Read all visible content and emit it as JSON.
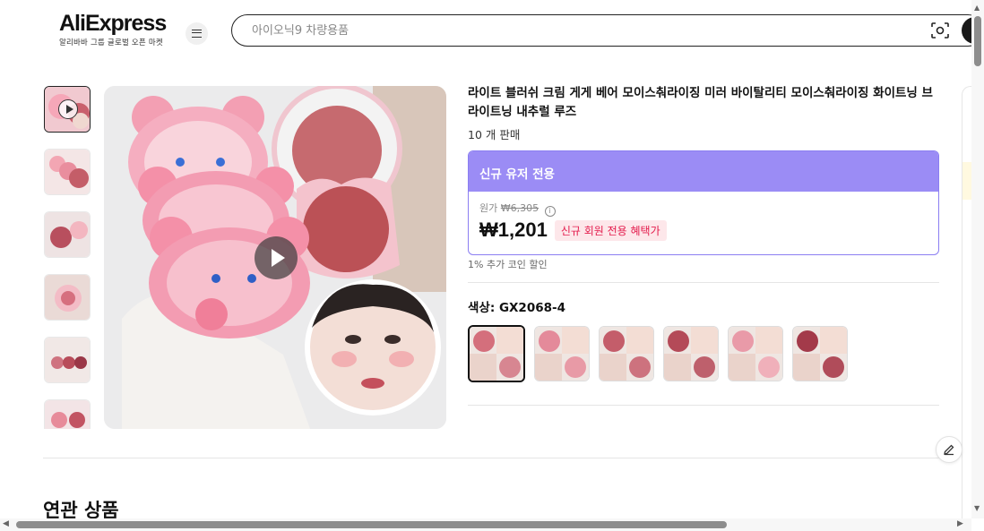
{
  "header": {
    "logo_text": "AliExpress",
    "logo_subtitle": "알리바바 그룹 글로벌 오픈 마켓",
    "menu_icon": "hamburger-icon",
    "search_placeholder": "아이오닉9 차량용품",
    "camera_icon": "camera-search-icon"
  },
  "gallery": {
    "thumbnail_count": 6,
    "active_index": 0,
    "first_is_video": true
  },
  "product": {
    "title": "라이트 블러쉬 크림 게게 베어 모이스춰라이징 미러 바이탈리티 모이스춰라이징 화이트닝 브라이트닝 내추럴 루즈",
    "sold": "10 개 판매",
    "promo_header": "신규 유저 전용",
    "original_label": "원가",
    "original_price": "₩6,305",
    "price": "₩1,201",
    "price_badge": "신규 회원 전용 혜택가",
    "coin_discount": "1% 추가 코인 할인",
    "color_label": "색상: GX2068-4",
    "swatch_count": 6,
    "selected_swatch": 0
  },
  "related_heading": "연관 상품",
  "colors": {
    "accent_purple": "#9b8cf5",
    "badge_red": "#e41c4d",
    "badge_bg": "#fde7ea"
  }
}
